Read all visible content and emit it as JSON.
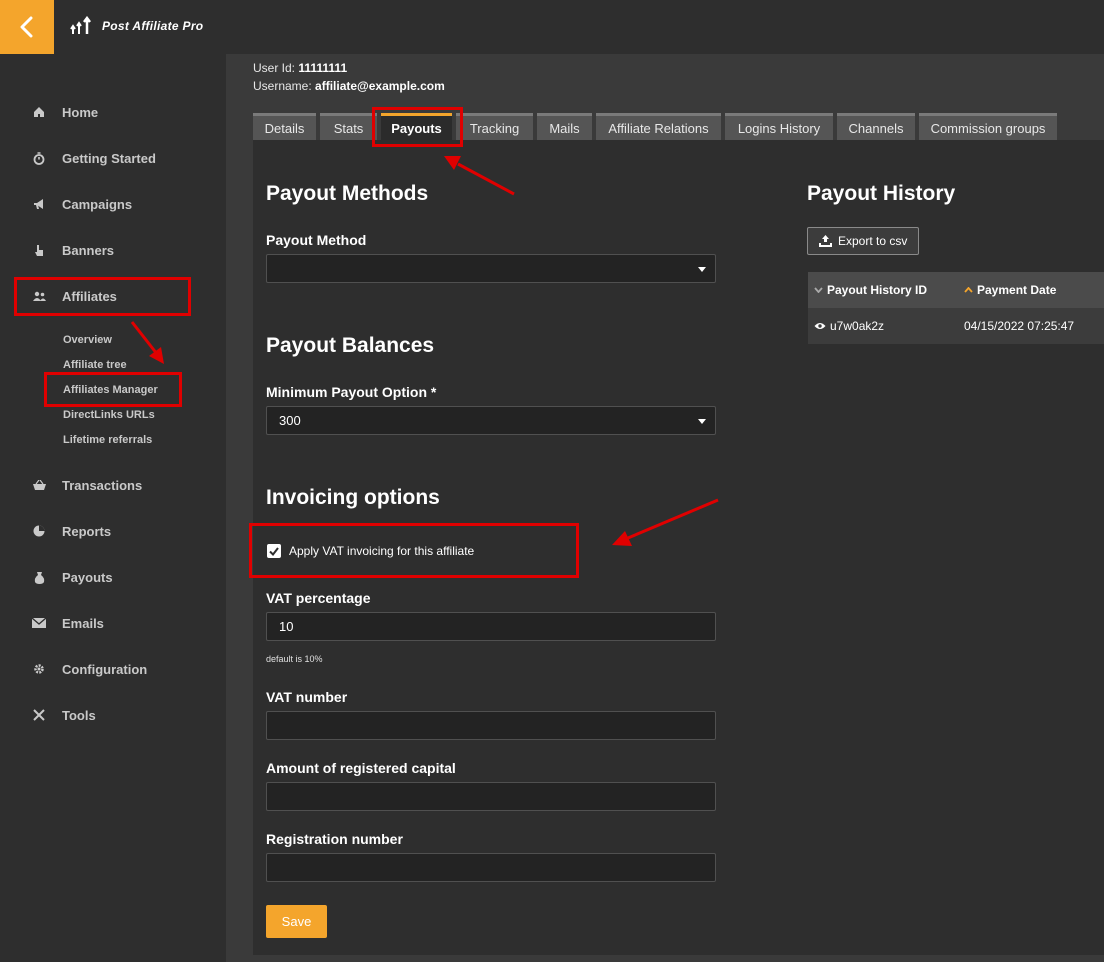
{
  "app": {
    "title": "Post Affiliate Pro"
  },
  "sidebar": {
    "items": [
      {
        "label": "Home",
        "icon": "home-icon"
      },
      {
        "label": "Getting Started",
        "icon": "stopwatch-icon"
      },
      {
        "label": "Campaigns",
        "icon": "megaphone-icon"
      },
      {
        "label": "Banners",
        "icon": "pointer-hand-icon"
      },
      {
        "label": "Affiliates",
        "icon": "users-icon"
      },
      {
        "label": "Transactions",
        "icon": "basket-icon"
      },
      {
        "label": "Reports",
        "icon": "pie-chart-icon"
      },
      {
        "label": "Payouts",
        "icon": "money-bag-icon"
      },
      {
        "label": "Emails",
        "icon": "envelope-icon"
      },
      {
        "label": "Configuration",
        "icon": "gear-icon"
      },
      {
        "label": "Tools",
        "icon": "tools-icon"
      }
    ],
    "affiliates_sub": [
      "Overview",
      "Affiliate tree",
      "Affiliates Manager",
      "DirectLinks URLs",
      "Lifetime referrals"
    ]
  },
  "user": {
    "id_label": "User Id:",
    "id_value": "11111111",
    "username_label": "Username:",
    "username_value": "affiliate@example.com"
  },
  "tabs": [
    "Details",
    "Stats",
    "Payouts",
    "Tracking",
    "Mails",
    "Affiliate Relations",
    "Logins History",
    "Channels",
    "Commission groups"
  ],
  "active_tab": "Payouts",
  "payout_methods": {
    "heading": "Payout Methods",
    "label": "Payout Method",
    "value": ""
  },
  "payout_balances": {
    "heading": "Payout Balances",
    "label": "Minimum Payout Option",
    "required_mark": "*",
    "value": "300"
  },
  "invoicing": {
    "heading": "Invoicing options",
    "vat_checkbox_label": "Apply VAT invoicing for this affiliate",
    "vat_checked": true,
    "vat_percentage_label": "VAT percentage",
    "vat_percentage_value": "10",
    "vat_hint": "default is 10%",
    "vat_number_label": "VAT number",
    "vat_number_value": "",
    "capital_label": "Amount of registered capital",
    "capital_value": "",
    "reg_number_label": "Registration number",
    "reg_number_value": ""
  },
  "save_label": "Save",
  "payout_history": {
    "heading": "Payout History",
    "export_label": "Export to csv",
    "columns": [
      "Payout History ID",
      "Payment Date"
    ],
    "rows": [
      {
        "id": "u7w0ak2z",
        "date": "04/15/2022 07:25:47"
      }
    ]
  },
  "colors": {
    "accent": "#f4a52c",
    "annotation": "#e00000",
    "sidebar_bg": "#2e2e2e",
    "panel_bg": "#2e2e2e"
  }
}
